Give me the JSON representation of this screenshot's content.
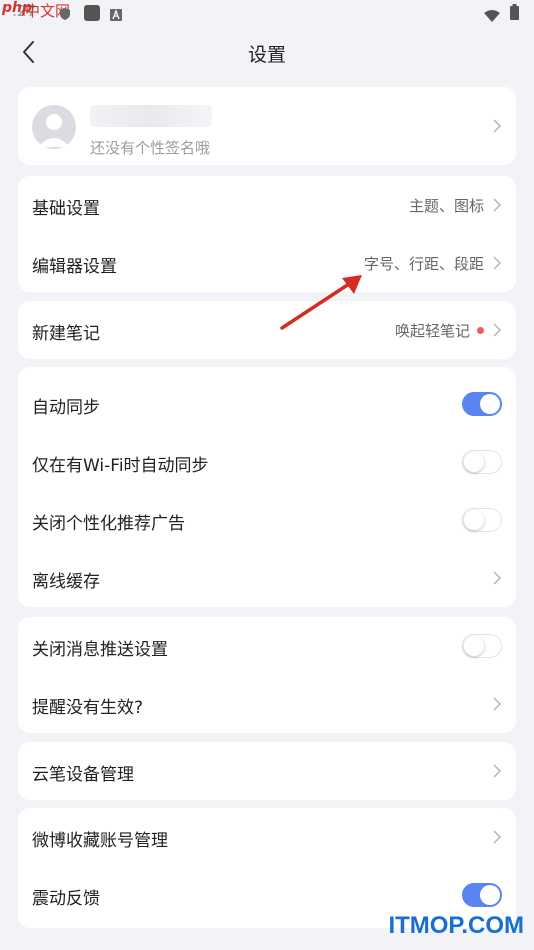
{
  "statusbar": {
    "time": ":27",
    "watermark_php": "php",
    "watermark_cn": "中文网",
    "icons": [
      "shield-icon",
      "square-icon",
      "a-icon",
      "wifi-icon",
      "battery-icon"
    ]
  },
  "header": {
    "title": "设置",
    "back_icon": "chevron-left-icon"
  },
  "profile": {
    "signature": "还没有个性签名哦"
  },
  "group1": {
    "basic_label": "基础设置",
    "basic_value": "主题、图标",
    "editor_label": "编辑器设置",
    "editor_value": "字号、行距、段距"
  },
  "group2": {
    "new_note_label": "新建笔记",
    "new_note_value": "唤起轻笔记"
  },
  "group3": {
    "auto_sync_label": "自动同步",
    "auto_sync_on": true,
    "wifi_sync_label": "仅在有Wi-Fi时自动同步",
    "wifi_sync_on": false,
    "ads_label": "关闭个性化推荐广告",
    "ads_on": false,
    "offline_label": "离线缓存"
  },
  "group4": {
    "push_label": "关闭消息推送设置",
    "push_on": false,
    "reminder_label": "提醒没有生效?"
  },
  "group5": {
    "pen_label": "云笔设备管理"
  },
  "group6": {
    "weibo_label": "微博收藏账号管理",
    "vibration_label": "震动反馈",
    "vibration_on": true
  },
  "colors": {
    "accent": "#5b84f3",
    "background": "#f2f3f7",
    "badge": "#f25c5c",
    "arrow": "#d62a22"
  },
  "watermark_footer": "ITMOP.COM"
}
